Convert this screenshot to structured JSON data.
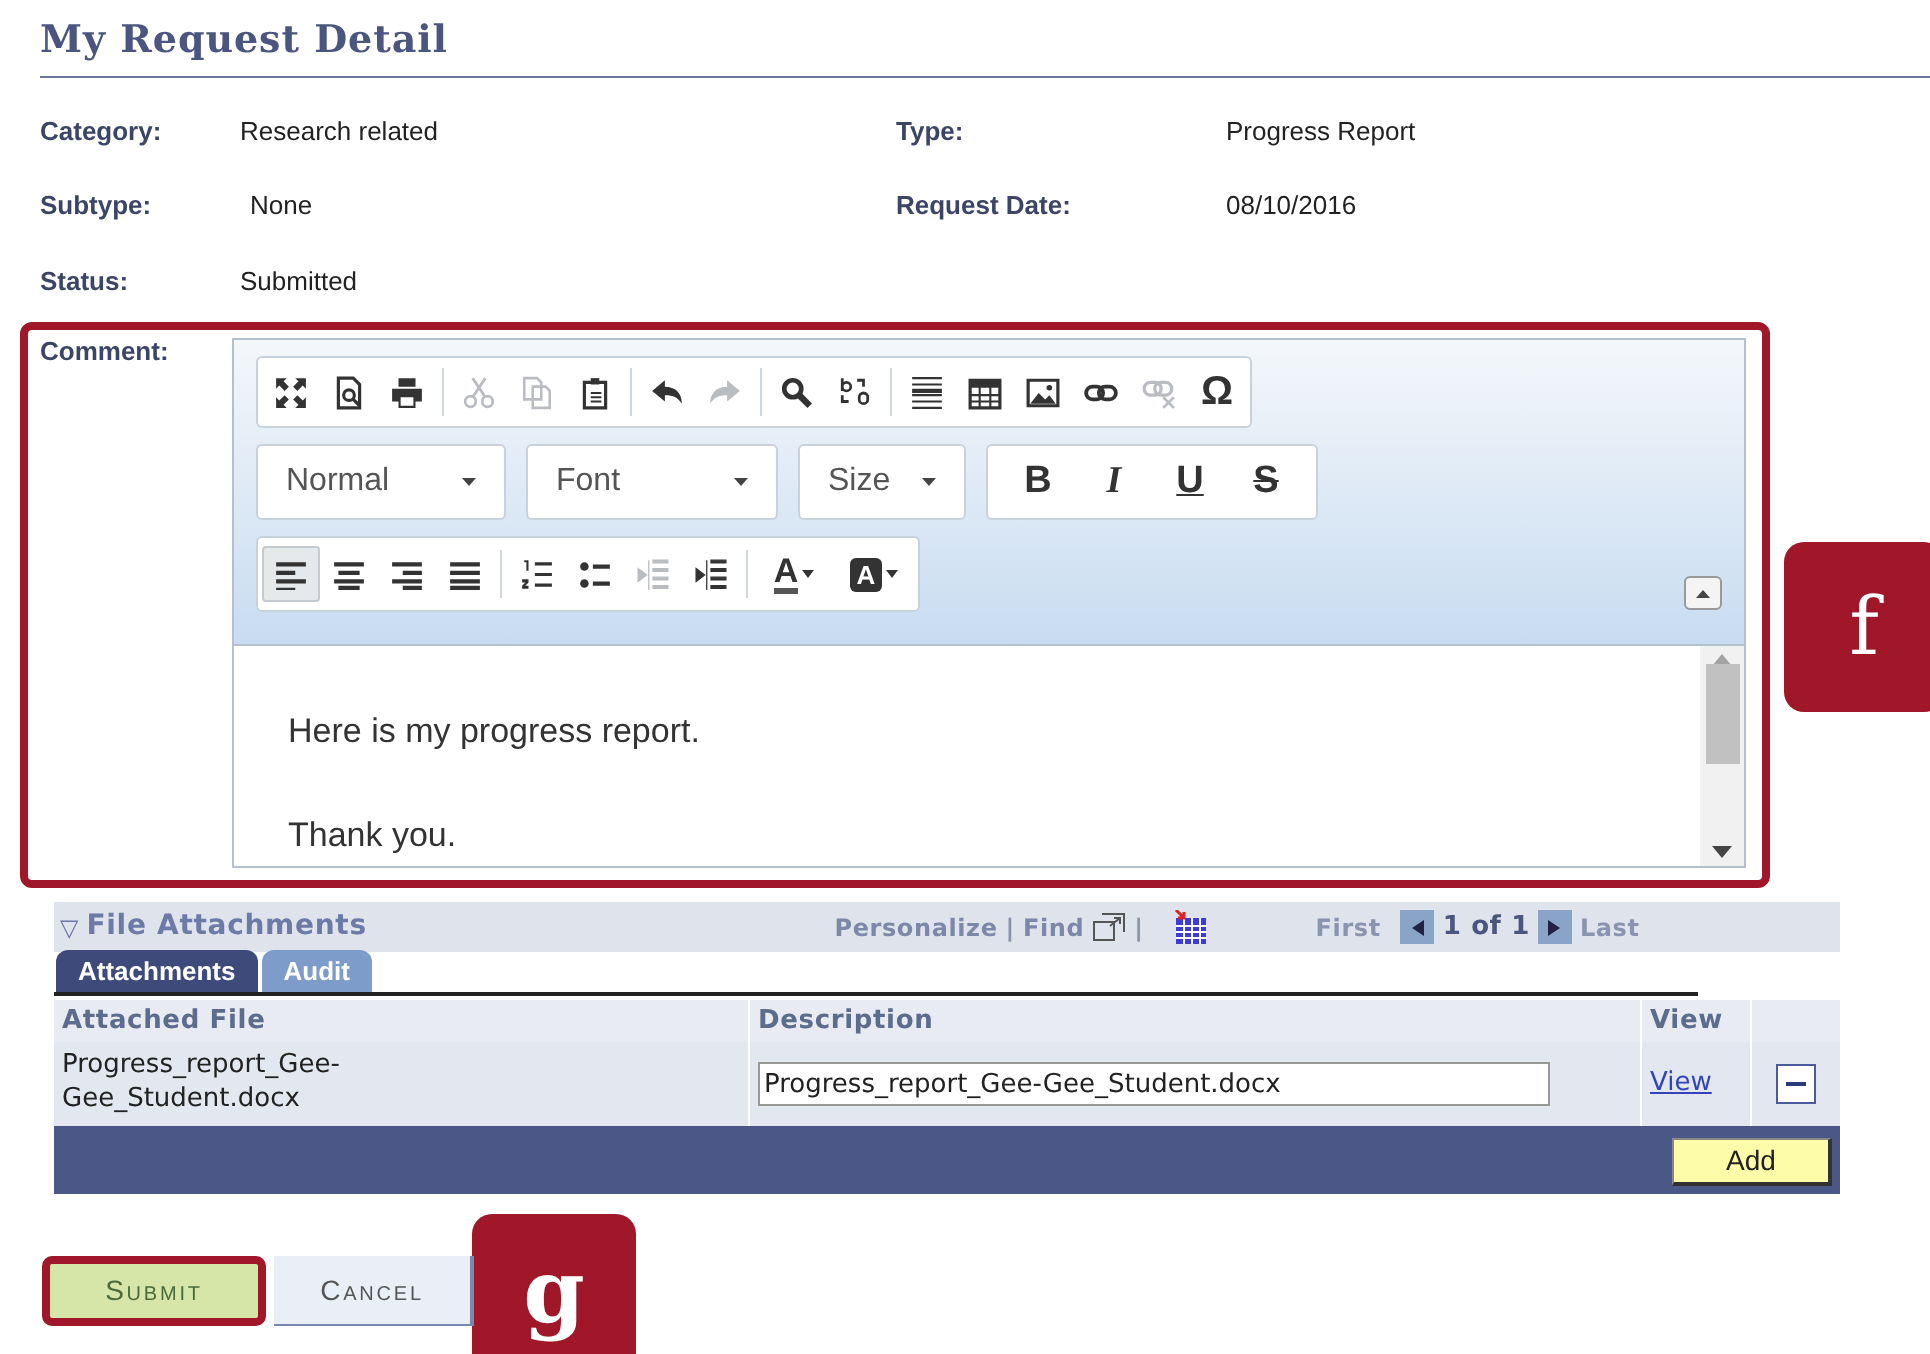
{
  "title": "My Request Detail",
  "fields": [
    {
      "label": "Category:",
      "value": "Research related"
    },
    {
      "label": "Type:",
      "value": "Progress Report"
    },
    {
      "label": "Subtype:",
      "value": "None"
    },
    {
      "label": "Request Date:",
      "value": "08/10/2016"
    },
    {
      "label": "Status:",
      "value": "Submitted"
    }
  ],
  "comment": {
    "label": "Comment:",
    "toolbar_1": [
      {
        "kind": "maximize",
        "disabled": false
      },
      {
        "kind": "preview",
        "disabled": false
      },
      {
        "kind": "print",
        "disabled": false
      },
      {
        "kind": "sep"
      },
      {
        "kind": "cut",
        "disabled": true
      },
      {
        "kind": "copy",
        "disabled": true
      },
      {
        "kind": "paste",
        "disabled": false
      },
      {
        "kind": "sep"
      },
      {
        "kind": "undo",
        "disabled": false
      },
      {
        "kind": "redo",
        "disabled": true
      },
      {
        "kind": "sep"
      },
      {
        "kind": "find",
        "disabled": false
      },
      {
        "kind": "replace",
        "disabled": false
      },
      {
        "kind": "sep"
      },
      {
        "kind": "rule",
        "disabled": false
      },
      {
        "kind": "table",
        "disabled": false
      },
      {
        "kind": "image",
        "disabled": false
      },
      {
        "kind": "link",
        "disabled": false
      },
      {
        "kind": "unlink",
        "disabled": true
      },
      {
        "kind": "char",
        "label": "Ω",
        "disabled": false
      }
    ],
    "dropdowns": [
      "Normal",
      "Font",
      "Size"
    ],
    "styles": [
      {
        "kind": "bold",
        "label": "B"
      },
      {
        "kind": "italic",
        "label": "I"
      },
      {
        "kind": "underline",
        "label": "U"
      },
      {
        "kind": "strike",
        "label": "S"
      }
    ],
    "toolbar_3": [
      {
        "kind": "align-left",
        "selected": true,
        "disabled": false
      },
      {
        "kind": "align-center",
        "selected": false,
        "disabled": false
      },
      {
        "kind": "align-right",
        "selected": false,
        "disabled": false
      },
      {
        "kind": "justify",
        "selected": false,
        "disabled": false
      },
      {
        "kind": "sep"
      },
      {
        "kind": "numbered-list",
        "selected": false,
        "disabled": false
      },
      {
        "kind": "bulleted-list",
        "selected": false,
        "disabled": false
      },
      {
        "kind": "outdent",
        "selected": false,
        "disabled": true
      },
      {
        "kind": "indent",
        "selected": false,
        "disabled": false
      },
      {
        "kind": "sep"
      },
      {
        "kind": "text-color",
        "label": "A",
        "selected": false
      },
      {
        "kind": "bg-color",
        "label": "A",
        "selected": false
      }
    ],
    "paragraphs": [
      "Here is my progress report.",
      "Thank you."
    ]
  },
  "attachments": {
    "toggle": "▽",
    "title": "File Attachments",
    "nav": [
      "Personalize",
      "|",
      "Find",
      "|"
    ],
    "first": "First",
    "page": "1 of 1",
    "last": "Last",
    "tabs": [
      {
        "label": "Attachments",
        "selected": true
      },
      {
        "label": "Audit",
        "selected": false
      }
    ],
    "columns": [
      "Attached File",
      "Description",
      "View"
    ],
    "rows": [
      {
        "file": "Progress_report_Gee-Gee_Student.docx",
        "description": "Progress_report_Gee-Gee_Student.docx",
        "view": "View"
      }
    ],
    "add": "Add"
  },
  "buttons": [
    {
      "label": "Submit",
      "highlighted": true
    },
    {
      "label": "Cancel",
      "highlighted": false
    }
  ],
  "callouts": [
    {
      "label": "f"
    },
    {
      "label": "g"
    }
  ]
}
